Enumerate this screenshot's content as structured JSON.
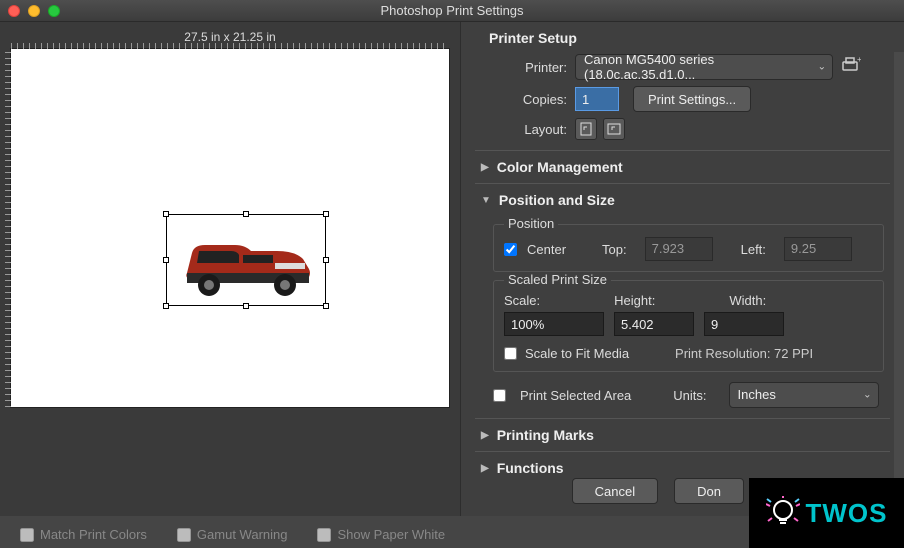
{
  "window": {
    "title": "Photoshop Print Settings"
  },
  "preview": {
    "dimensions": "27.5 in x 21.25 in"
  },
  "bottom": {
    "match_colors": "Match Print Colors",
    "gamut_warning": "Gamut Warning",
    "show_paper_white": "Show Paper White"
  },
  "printerSetup": {
    "heading": "Printer Setup",
    "printer_label": "Printer:",
    "printer_value": "Canon MG5400 series (18.0c.ac.35.d1.0...",
    "copies_label": "Copies:",
    "copies_value": "1",
    "print_settings_btn": "Print Settings...",
    "layout_label": "Layout:"
  },
  "sections": {
    "color_mgmt": "Color Management",
    "position_size": "Position and Size",
    "printing_marks": "Printing Marks",
    "functions": "Functions"
  },
  "position": {
    "legend": "Position",
    "center": "Center",
    "top_label": "Top:",
    "top_value": "7.923",
    "left_label": "Left:",
    "left_value": "9.25"
  },
  "scaled": {
    "legend": "Scaled Print Size",
    "scale_label": "Scale:",
    "height_label": "Height:",
    "width_label": "Width:",
    "scale_value": "100%",
    "height_value": "5.402",
    "width_value": "9",
    "fit_media": "Scale to Fit Media",
    "resolution": "Print Resolution: 72 PPI"
  },
  "units": {
    "psa": "Print Selected Area",
    "units_label": "Units:",
    "units_value": "Inches"
  },
  "actions": {
    "cancel": "Cancel",
    "done": "Don"
  },
  "overlay": {
    "text": "TWOS"
  }
}
